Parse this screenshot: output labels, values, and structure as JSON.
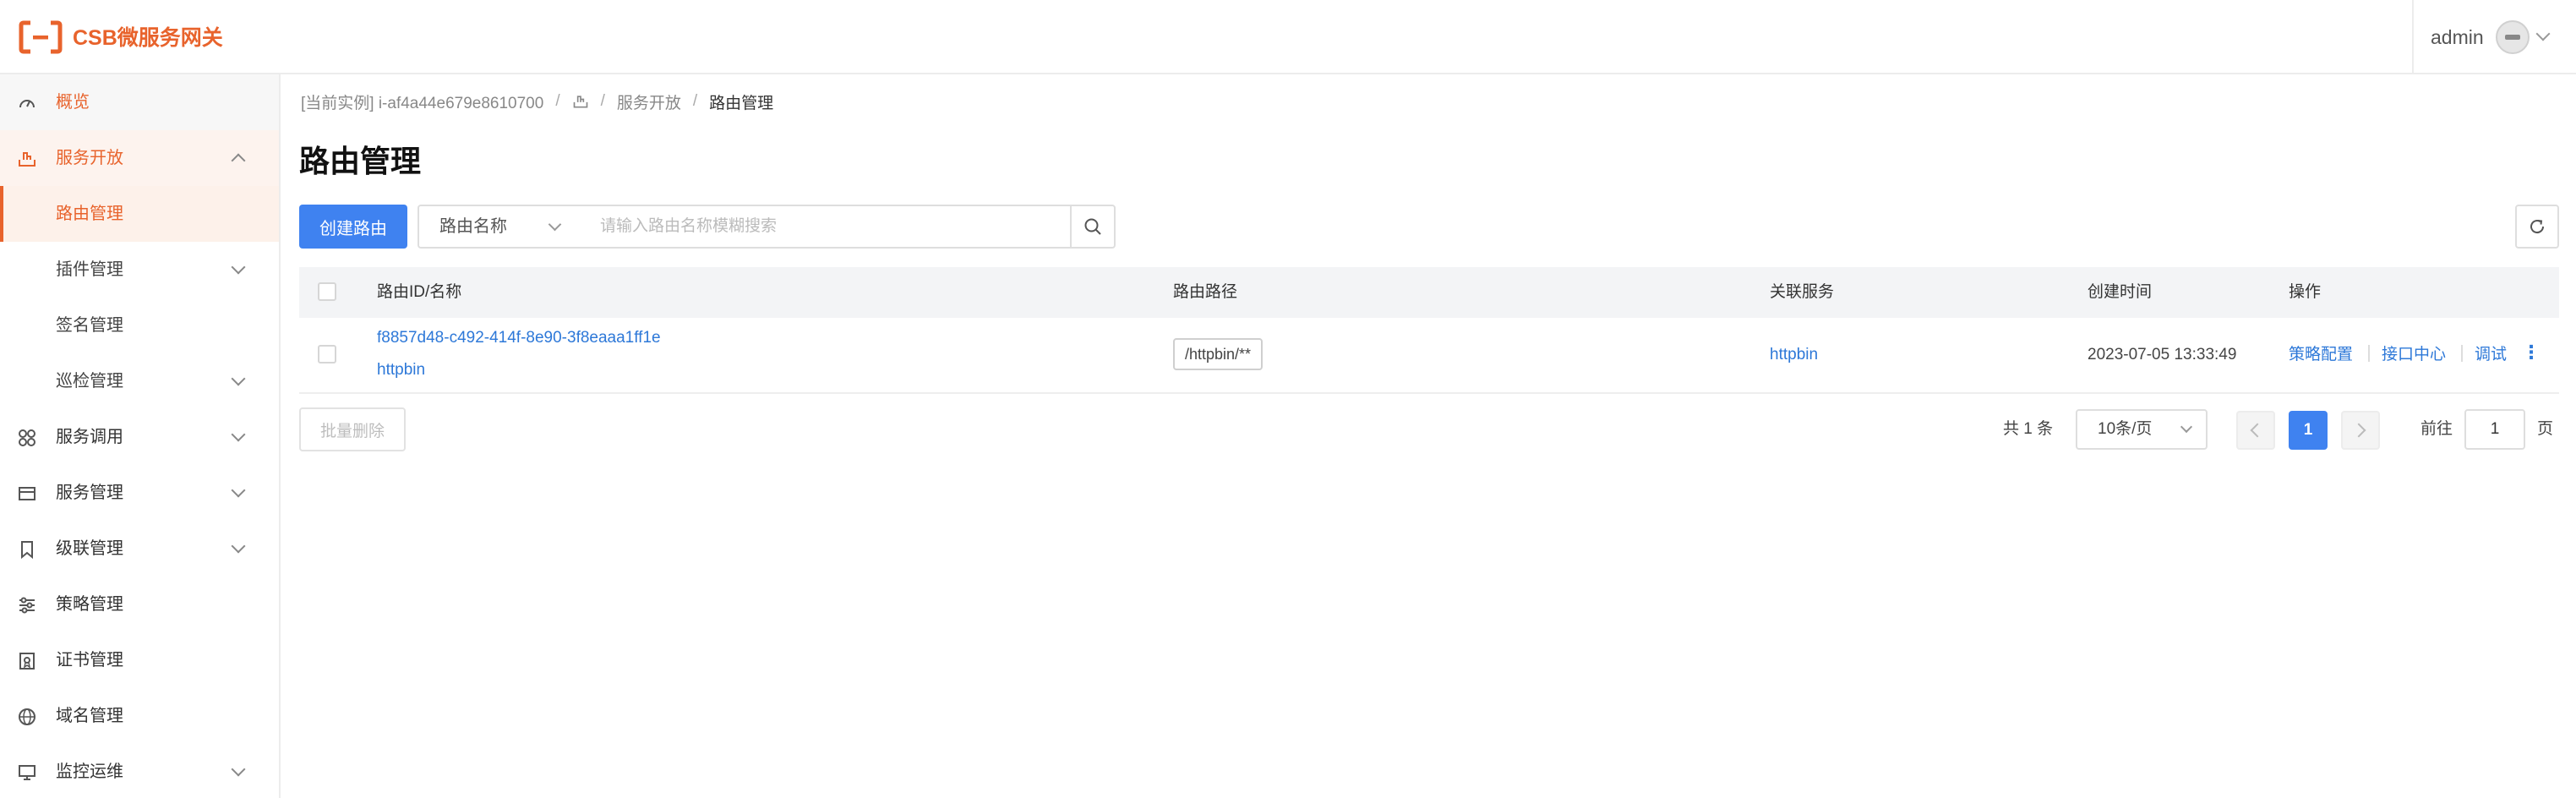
{
  "app": {
    "brand": "CSB微服务网关",
    "user": "admin"
  },
  "sidebar": {
    "items": [
      {
        "label": "概览",
        "icon": "dashboard-icon"
      },
      {
        "label": "服务开放",
        "icon": "service-open-icon",
        "expanded": true
      },
      {
        "label": "路由管理",
        "sub": true,
        "active": true
      },
      {
        "label": "插件管理",
        "sub": true
      },
      {
        "label": "签名管理",
        "sub": true
      },
      {
        "label": "巡检管理",
        "sub": true
      },
      {
        "label": "服务调用",
        "icon": "service-call-icon"
      },
      {
        "label": "服务管理",
        "icon": "service-manage-icon"
      },
      {
        "label": "级联管理",
        "icon": "bookmark-icon"
      },
      {
        "label": "策略管理",
        "icon": "sliders-icon"
      },
      {
        "label": "证书管理",
        "icon": "certificate-icon"
      },
      {
        "label": "域名管理",
        "icon": "globe-icon"
      },
      {
        "label": "监控运维",
        "icon": "monitor-icon"
      }
    ]
  },
  "breadcrumb": {
    "instance": "[当前实例] i-af4a44e679e8610700",
    "sep": "/",
    "parent": "服务开放",
    "current": "路由管理"
  },
  "page": {
    "title": "路由管理"
  },
  "toolbar": {
    "create_label": "创建路由",
    "filter_field": "路由名称",
    "search_placeholder": "请输入路由名称模糊搜索"
  },
  "table": {
    "headers": {
      "id_name": "路由ID/名称",
      "path": "路由路径",
      "service": "关联服务",
      "created": "创建时间",
      "actions": "操作"
    },
    "rows": [
      {
        "id": "f8857d48-c492-414f-8e90-3f8eaaa1ff1e",
        "name": "httpbin",
        "path": "/httpbin/**",
        "service": "httpbin",
        "created": "2023-07-05 13:33:49",
        "actions": [
          "策略配置",
          "接口中心",
          "调试"
        ],
        "more": "⋮"
      }
    ]
  },
  "batch_delete_label": "批量删除",
  "pagination": {
    "total": "共 1 条",
    "page_size": "10条/页",
    "current": "1",
    "goto_label": "前往",
    "goto_value": "1",
    "page_suffix": "页"
  },
  "colors": {
    "brand": "#e8632c",
    "primary": "#3f82f0",
    "link": "#2d78d8"
  }
}
